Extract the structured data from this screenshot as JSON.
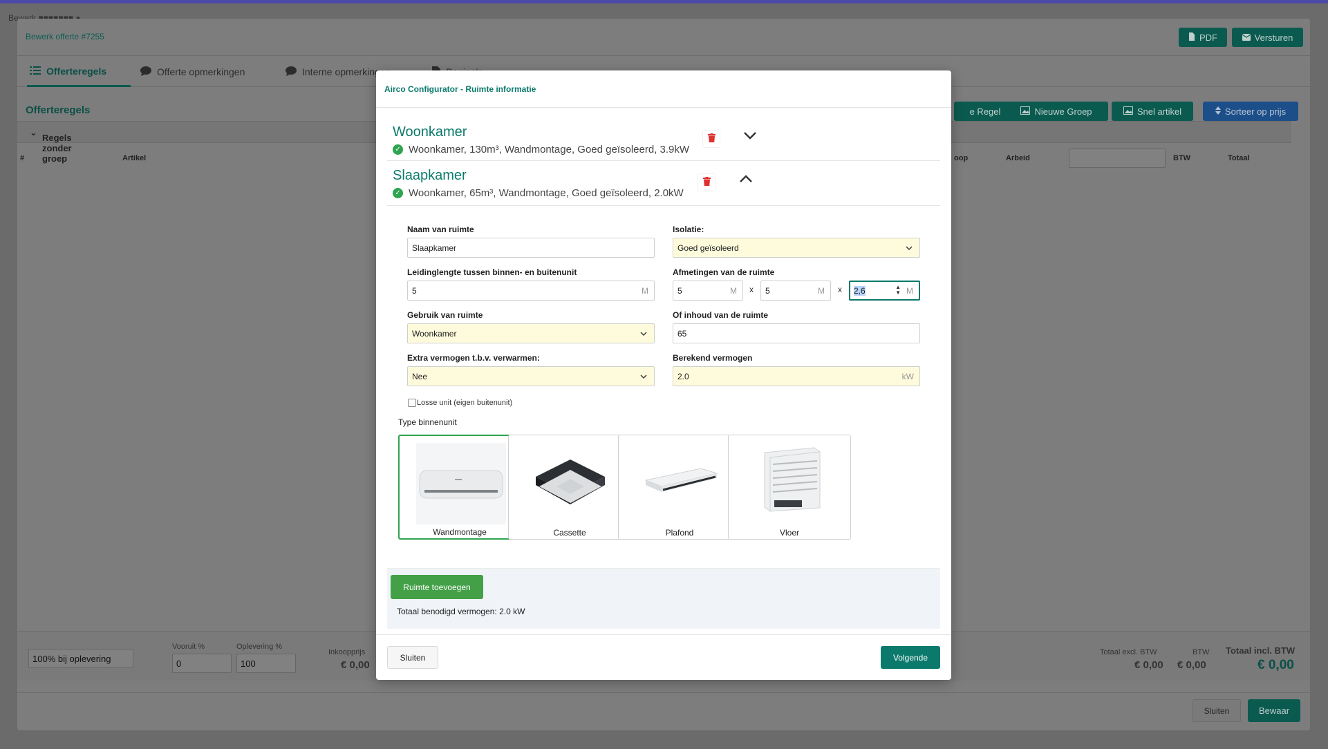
{
  "back": {
    "crumb": "Bewerk    ■■■■■■■  ●",
    "title": "Bewerk offerte #7255",
    "pdf": "PDF",
    "send": "Versturen",
    "tabs": [
      "Offerteregels",
      "Offerte opmerkingen",
      "Interne opmerkingen",
      "Pagina's"
    ],
    "section": "Offerteregels",
    "group": "Regels zonder groep",
    "buttons": [
      "e Regel",
      "Nieuwe Groep",
      "Snel artikel",
      "Sorteer op prijs"
    ],
    "columns": {
      "hash": "#",
      "artikel": "Artikel",
      "koop": "oop",
      "arbeid": "Arbeid",
      "btw": "BTW",
      "totaal": "Totaal"
    },
    "footer": {
      "payment": "100% bij oplevering",
      "vooruit_label": "Vooruit %",
      "vooruit_value": "0",
      "oplevering_label": "Oplevering %",
      "oplevering_value": "100",
      "inkoop_label": "Inkoopprijs",
      "inkoop_value": "€ 0,00",
      "excl_label": "Totaal excl. BTW",
      "excl_value": "€ 0,00",
      "btw_label": "BTW",
      "btw_value": "€ 0,00",
      "incl_label": "Totaal incl. BTW",
      "incl_value": "€ 0,00"
    },
    "close": "Sluiten",
    "save": "Bewaar"
  },
  "modal": {
    "title": "Airco Configurator - Ruimte informatie",
    "rooms": [
      {
        "name": "Woonkamer",
        "summary": "Woonkamer, 130m³, Wandmontage, Goed geïsoleerd, 3.9kW"
      },
      {
        "name": "Slaapkamer",
        "summary": "Woonkamer, 65m³, Wandmontage, Goed geïsoleerd, 2.0kW"
      }
    ],
    "form": {
      "naam_label": "Naam van ruimte",
      "naam_value": "Slaapkamer",
      "isolatie_label": "Isolatie:",
      "isolatie_value": "Goed geïsoleerd",
      "leiding_label": "Leidinglengte tussen binnen- en buitenunit",
      "leiding_value": "5",
      "unit_m": "M",
      "afm_label": "Afmetingen van de ruimte",
      "afm_l": "5",
      "afm_b": "5",
      "afm_h": "2,6",
      "x": "x",
      "gebruik_label": "Gebruik van ruimte",
      "gebruik_value": "Woonkamer",
      "inhoud_label": "Of inhoud van de ruimte",
      "inhoud_value": "65",
      "extra_label": "Extra vermogen t.b.v. verwarmen:",
      "extra_value": "Nee",
      "berekend_label": "Berekend vermogen",
      "berekend_value": "2.0",
      "unit_kw": "kW",
      "losse_label": "Losse unit (eigen buitenunit)",
      "type_label": "Type binnenunit",
      "types": [
        "Wandmontage",
        "Cassette",
        "Plafond",
        "Vloer"
      ]
    },
    "add_room": "Ruimte toevoegen",
    "total": "Totaal benodigd vermogen: 2.0 kW",
    "close": "Sluiten",
    "next": "Volgende"
  }
}
